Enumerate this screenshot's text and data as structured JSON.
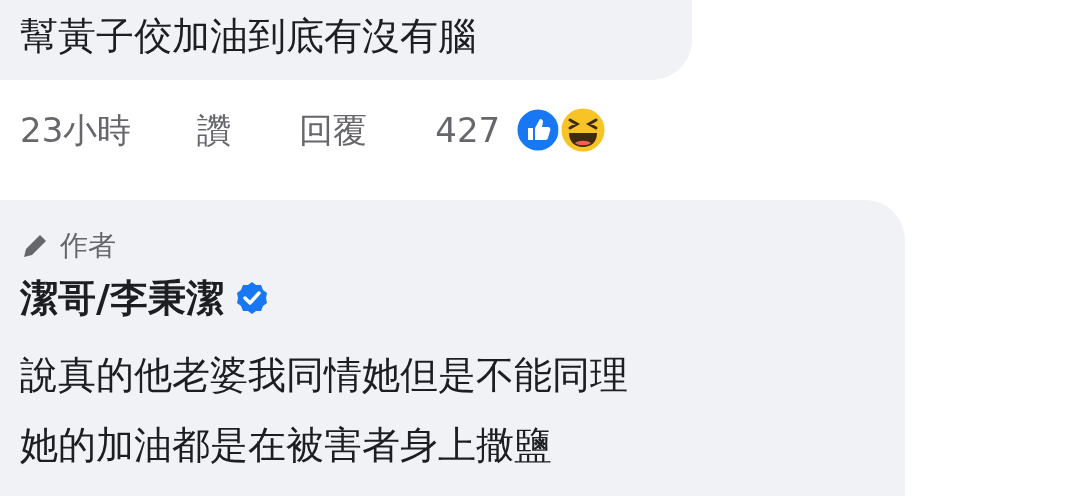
{
  "comment": {
    "text": "幫黃子佼加油到底有沒有腦"
  },
  "actions": {
    "time": "23小時",
    "like": "讚",
    "reply": "回覆",
    "reaction_count": "427"
  },
  "reply": {
    "badge": "作者",
    "author": "潔哥/李秉潔",
    "verified": true,
    "lines": [
      "說真的他老婆我同情她但是不能同理",
      "她的加油都是在被害者身上撒鹽"
    ]
  }
}
